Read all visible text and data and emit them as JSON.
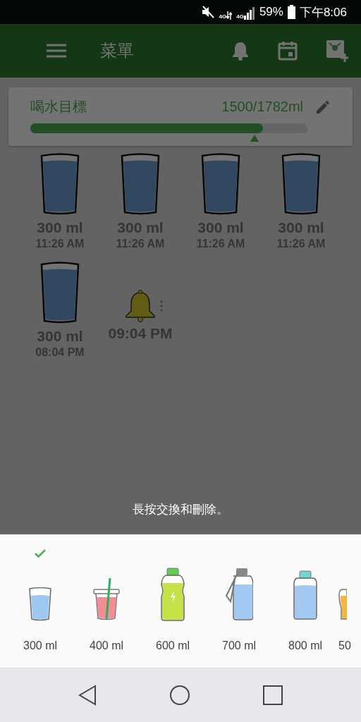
{
  "status_bar": {
    "network_labels": [
      "4G",
      "4G"
    ],
    "battery": "59%",
    "time": "下午8:06"
  },
  "app_bar": {
    "title": "菜單"
  },
  "goal": {
    "title": "喝水目標",
    "reading": "1500/1782ml",
    "level": 0.84
  },
  "log": [
    {
      "kind": "drink",
      "amount": "300 ml",
      "time": "11:26 AM"
    },
    {
      "kind": "drink",
      "amount": "300 ml",
      "time": "11:26 AM"
    },
    {
      "kind": "drink",
      "amount": "300 ml",
      "time": "11:26 AM"
    },
    {
      "kind": "drink",
      "amount": "300 ml",
      "time": "11:26 AM"
    },
    {
      "kind": "drink",
      "amount": "300 ml",
      "time": "08:04 PM"
    },
    {
      "kind": "reminder",
      "time": "09:04 PM"
    }
  ],
  "hint": "長按交換和刪除。",
  "cups": [
    {
      "kind": "glass",
      "label": "300 ml",
      "selected": true
    },
    {
      "kind": "straw-cup",
      "label": "400 ml",
      "selected": false
    },
    {
      "kind": "sport-bottle",
      "label": "600 ml",
      "selected": false
    },
    {
      "kind": "strap-bottle",
      "label": "700 ml",
      "selected": false
    },
    {
      "kind": "bottle",
      "label": "800 ml",
      "selected": false
    },
    {
      "kind": "beer-glass",
      "label": "50",
      "selected": false
    }
  ]
}
